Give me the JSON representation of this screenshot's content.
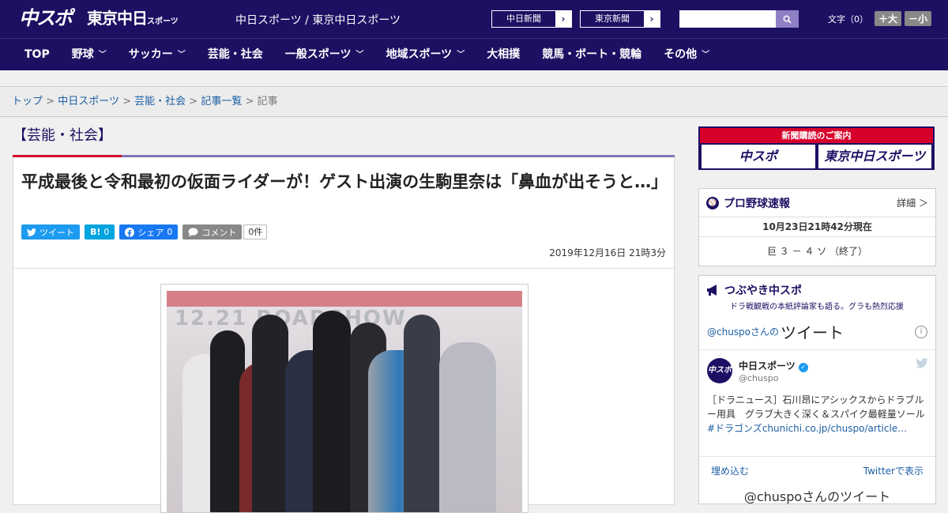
{
  "header": {
    "logo_main": "中スポ",
    "logo_tokyo": "東京中日",
    "logo_tokyo_small": "スポーツ",
    "site_name": "中日スポーツ / 東京中日スポーツ",
    "ext_links": [
      {
        "label": "中日新聞"
      },
      {
        "label": "東京新聞"
      }
    ],
    "arrow": "›",
    "search_placeholder": "",
    "font_label": "文字（0）",
    "font_large": "＋大",
    "font_small": "－小"
  },
  "nav": {
    "items": [
      {
        "label": "TOP",
        "dropdown": false
      },
      {
        "label": "野球",
        "dropdown": true
      },
      {
        "label": "サッカー",
        "dropdown": true
      },
      {
        "label": "芸能・社会",
        "dropdown": false
      },
      {
        "label": "一般スポーツ",
        "dropdown": true
      },
      {
        "label": "地域スポーツ",
        "dropdown": true
      },
      {
        "label": "大相撲",
        "dropdown": false
      },
      {
        "label": "競馬・ボート・競輪",
        "dropdown": false
      },
      {
        "label": "その他",
        "dropdown": true
      }
    ],
    "chevron": "﹀"
  },
  "breadcrumb": {
    "items": [
      "トップ",
      "中日スポーツ",
      "芸能・社会",
      "記事一覧"
    ],
    "separator": ">",
    "current": "記事"
  },
  "article": {
    "category": "【芸能・社会】",
    "title": "平成最後と令和最初の仮面ライダーが！ゲスト出演の生駒里奈は「鼻血が出そうと…」",
    "share": {
      "tweet": "ツイート",
      "hatena": "B!",
      "hatena_count": "0",
      "facebook": "シェア",
      "facebook_count": "0",
      "comment": "コメント",
      "comment_count": "0件"
    },
    "date": "2019年12月16日 21時3分",
    "photo_text": "12.21 ROADSHOW"
  },
  "sidebar": {
    "subscribe_title": "新聞購読のご案内",
    "subscribe_links": [
      "中スポ",
      "東京中日スポーツ"
    ],
    "baseball": {
      "title": "プロ野球速報",
      "more": "詳細 ＞",
      "time": "10月23日21時42分現在",
      "score": "巨 ３ － ４ ソ （終了）"
    },
    "tsubuyaki": {
      "title": "つぶやき中スポ",
      "subtitle": "ドラ戦観戦の本紙評論家も語る。グラも熱烈応援",
      "header_user": "@chuspoさんの",
      "header_label": "ツイート",
      "tweet_name": "中日スポーツ",
      "tweet_handle": "@chuspo",
      "tweet_text": "［ドラニュース］石川昂にアシックスからドラブルー用具　グラブ大きく深く＆スパイク最軽量ソール",
      "tweet_link": "#ドラゴンズchunichi.co.jp/chuspo/article…",
      "embed": "埋め込む",
      "view_on_twitter": "Twitterで表示",
      "more": "@chuspoさんのツイート"
    }
  },
  "colors": {
    "brand": "#1c1063",
    "accent": "#d7002a",
    "link": "#1c5fa5",
    "twitter": "#1d9bf0",
    "facebook": "#1877f2",
    "hatena": "#00a4de"
  }
}
